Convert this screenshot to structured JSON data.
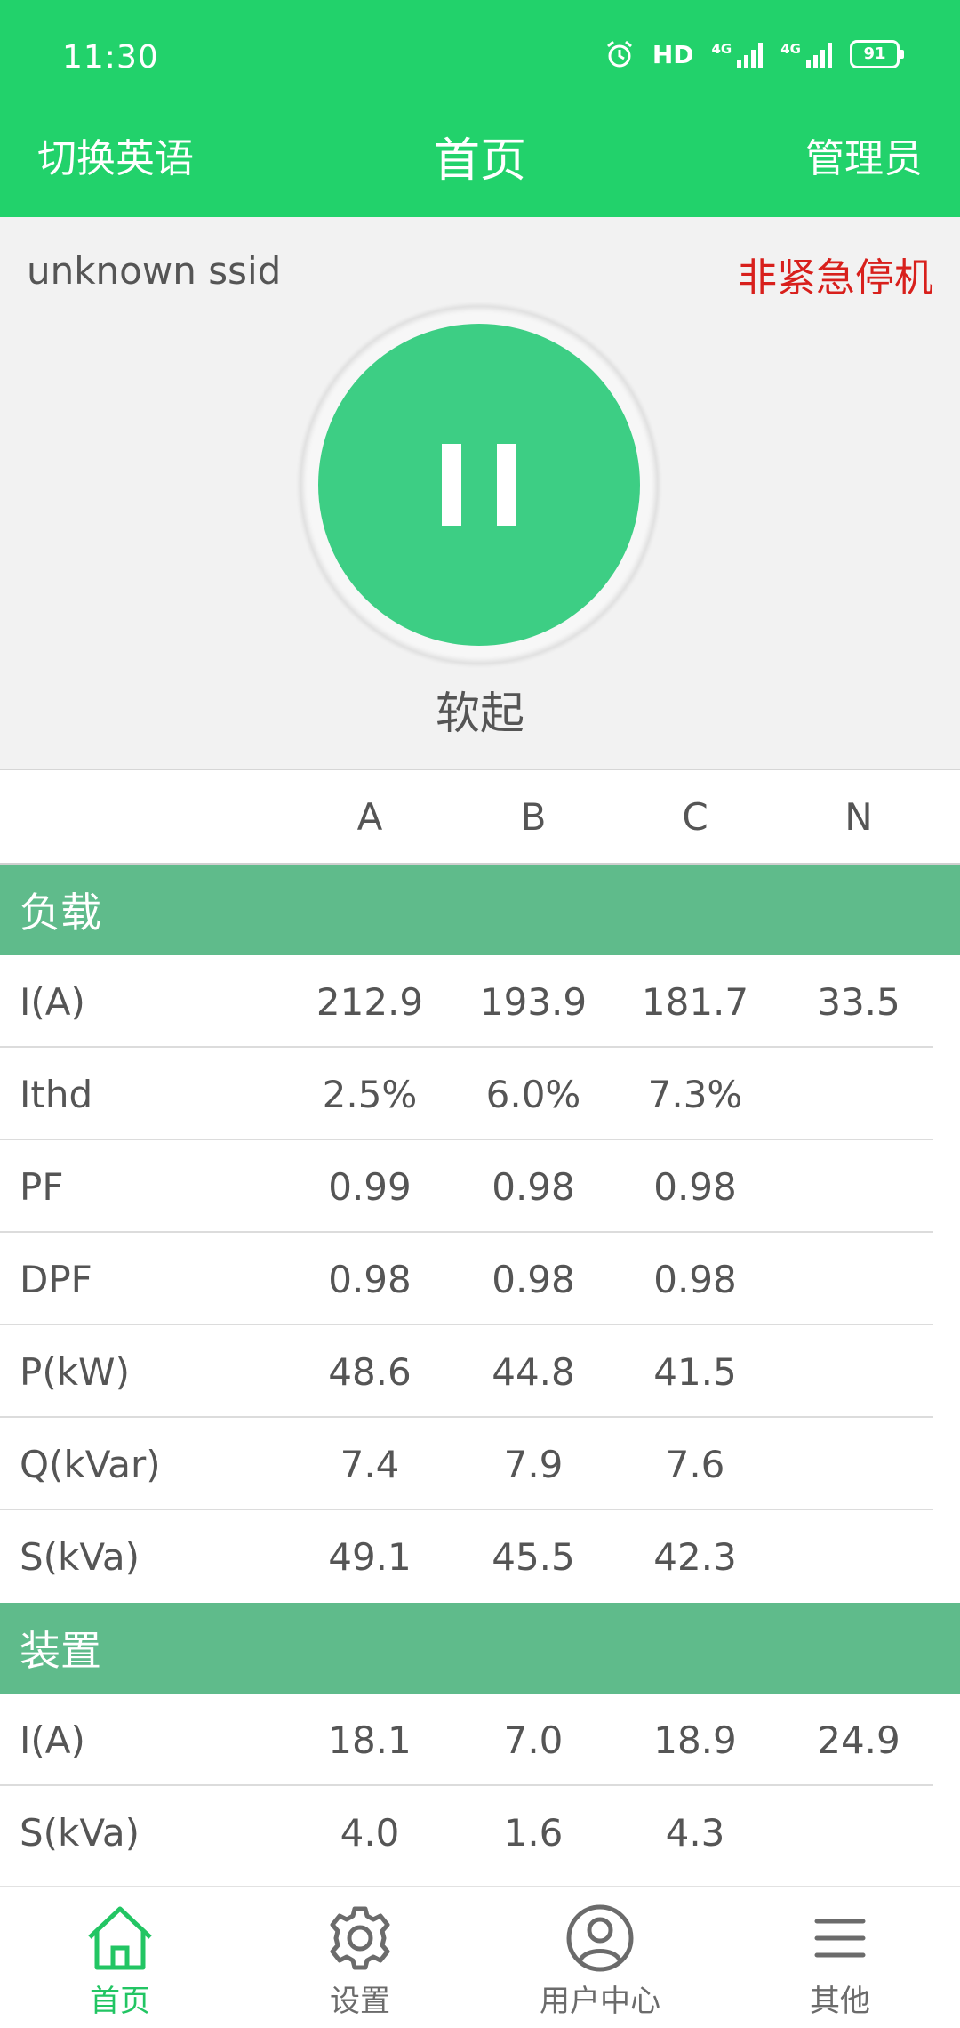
{
  "status_bar": {
    "time": "11:30",
    "hd": "HD",
    "net1": "4G",
    "net2": "4G",
    "battery": "91"
  },
  "header": {
    "left": "切换英语",
    "title": "首页",
    "right": "管理员"
  },
  "control": {
    "ssid": "unknown ssid",
    "emergency_status": "非紧急停机",
    "mode": "软起"
  },
  "table": {
    "columns": [
      "A",
      "B",
      "C",
      "N"
    ],
    "sections": [
      {
        "title": "负载",
        "rows": [
          {
            "label": "I(A)",
            "values": [
              "212.9",
              "193.9",
              "181.7",
              "33.5"
            ]
          },
          {
            "label": "Ithd",
            "values": [
              "2.5%",
              "6.0%",
              "7.3%",
              ""
            ]
          },
          {
            "label": "PF",
            "values": [
              "0.99",
              "0.98",
              "0.98",
              ""
            ]
          },
          {
            "label": "DPF",
            "values": [
              "0.98",
              "0.98",
              "0.98",
              ""
            ]
          },
          {
            "label": "P(kW)",
            "values": [
              "48.6",
              "44.8",
              "41.5",
              ""
            ]
          },
          {
            "label": "Q(kVar)",
            "values": [
              "7.4",
              "7.9",
              "7.6",
              ""
            ]
          },
          {
            "label": "S(kVa)",
            "values": [
              "49.1",
              "45.5",
              "42.3",
              ""
            ]
          }
        ]
      },
      {
        "title": "装置",
        "rows": [
          {
            "label": "I(A)",
            "values": [
              "18.1",
              "7.0",
              "18.9",
              "24.9"
            ]
          },
          {
            "label": "S(kVa)",
            "values": [
              "4.0",
              "1.6",
              "4.3",
              ""
            ]
          }
        ]
      }
    ]
  },
  "bottom_nav": [
    {
      "label": "首页",
      "icon": "home-icon",
      "active": true
    },
    {
      "label": "设置",
      "icon": "gear-icon",
      "active": false
    },
    {
      "label": "用户中心",
      "icon": "user-icon",
      "active": false
    },
    {
      "label": "其他",
      "icon": "menu-icon",
      "active": false
    }
  ],
  "colors": {
    "primary": "#22d26b",
    "button": "#3dce84",
    "section": "#5fbb8b",
    "alert": "#d8201c"
  }
}
